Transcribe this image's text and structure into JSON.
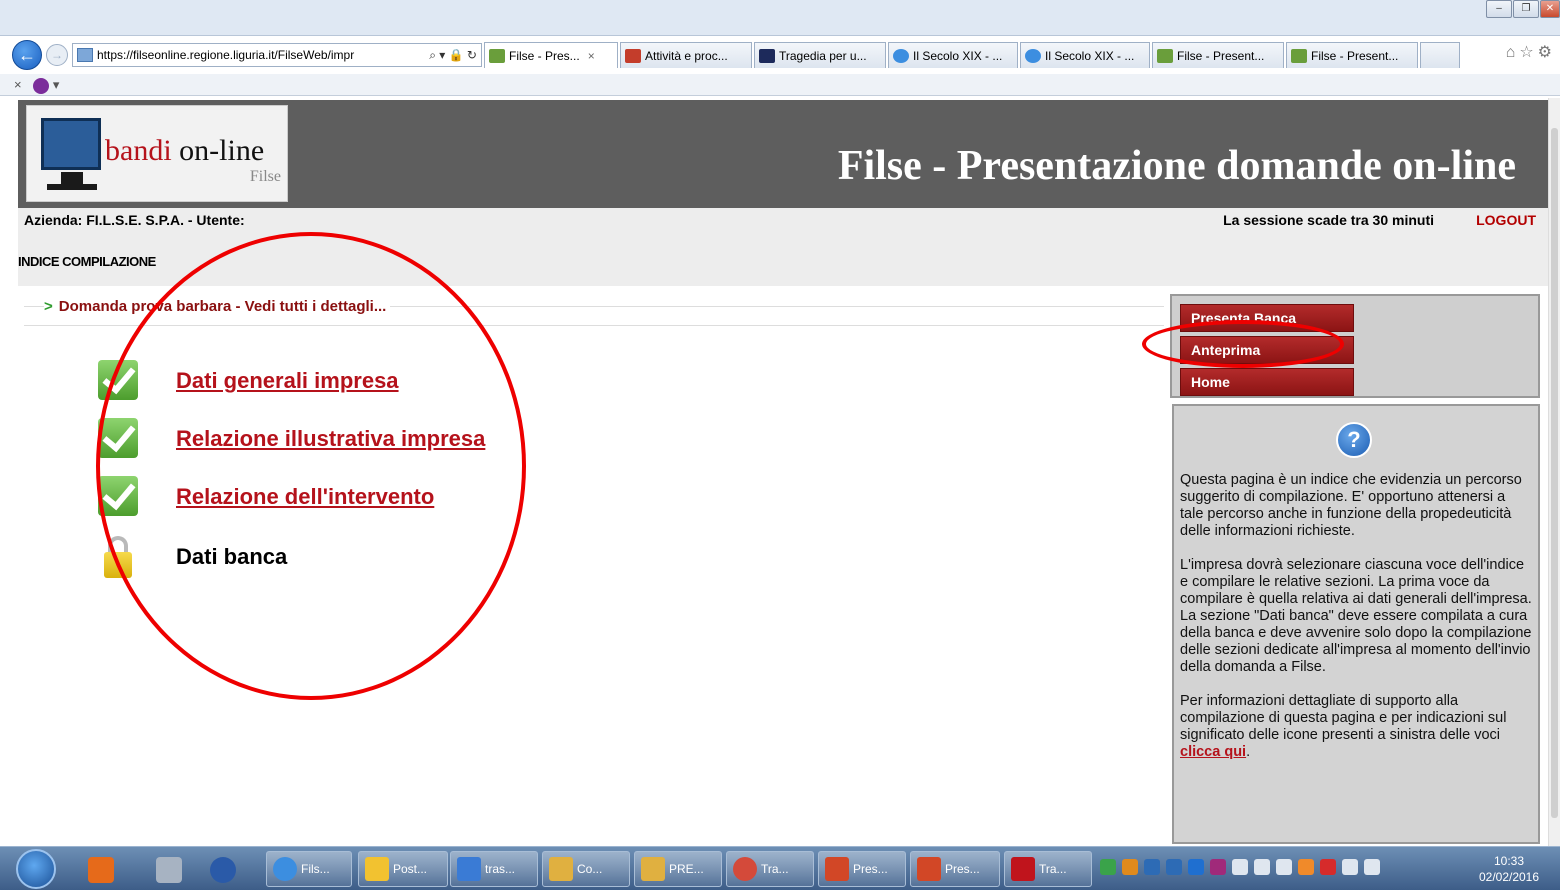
{
  "browser": {
    "url": "https://filseonline.regione.liguria.it/FilseWeb/impr",
    "address_controls": "⌕ ▾ 🔒 ↻",
    "tabs": [
      {
        "label": "Filse - Pres...",
        "close": "×",
        "color": "#6a9e3b"
      },
      {
        "label": "Attività e proc...",
        "color": "#c43d2b"
      },
      {
        "label": "Tragedia per u...",
        "color": "#1d2a5b"
      },
      {
        "label": "Il Secolo XIX - ...",
        "color": "#3c8ee0"
      },
      {
        "label": "Il Secolo XIX - ...",
        "color": "#3c8ee0"
      },
      {
        "label": "Filse - Present...",
        "color": "#6a9e3b"
      },
      {
        "label": "Filse - Present...",
        "color": "#6a9e3b"
      }
    ],
    "command_close": "×",
    "command_arrow": "▾"
  },
  "header": {
    "logo_text_a": "bandi",
    "logo_text_b": " on-line",
    "logo_sub": "Filse",
    "title": "Filse - Presentazione domande on-line"
  },
  "info": {
    "company": "Azienda: FI.L.S.E. S.P.A. - Utente:",
    "session": "La sessione scade tra 30 minuti",
    "logout": "LOGOUT",
    "index_heading": "INDICE COMPILAZIONE"
  },
  "breadcrumb": {
    "arrow": ">",
    "text": "Domanda prova barbara - Vedi tutti i dettagli..."
  },
  "index_items": [
    {
      "label": "Dati generali impresa",
      "status": "complete"
    },
    {
      "label": "Relazione illustrativa impresa",
      "status": "complete"
    },
    {
      "label": "Relazione dell'intervento",
      "status": "complete"
    },
    {
      "label": "Dati banca",
      "status": "locked"
    }
  ],
  "actions": {
    "presenta": "Presenta Banca",
    "anteprima": "Anteprima",
    "home": "Home"
  },
  "help": {
    "icon_glyph": "?",
    "p1": "Questa pagina è un indice che evidenzia un percorso suggerito di compilazione. E' opportuno attenersi a tale percorso anche in funzione della propedeuticità delle informazioni richieste.",
    "p2": "L'impresa dovrà selezionare ciascuna voce dell'indice e compilare le relative sezioni. La prima voce da compilare è quella relativa ai dati generali dell'impresa.",
    "p3": "La sezione \"Dati banca\" deve essere compilata a cura della banca e deve avvenire solo dopo la compilazione delle sezioni dedicate all'impresa al momento dell'invio della domanda a Filse.",
    "p4": "Per informazioni dettagliate di supporto alla compilazione di questa pagina e per indicazioni sul significato delle icone presenti a sinistra delle voci",
    "link": "clicca qui",
    "p4_end": "."
  },
  "taskbar": {
    "tasks": [
      {
        "label": "Fils...",
        "color": "#3c8ee0"
      },
      {
        "label": "Post...",
        "color": "#f2c230"
      },
      {
        "label": "tras...",
        "color": "#3a7bd5"
      },
      {
        "label": "Co...",
        "color": "#e0b040"
      },
      {
        "label": "PRE...",
        "color": "#e0b040"
      },
      {
        "label": "Tra...",
        "color": "#d44a3a"
      },
      {
        "label": "Pres...",
        "color": "#d24726"
      },
      {
        "label": "Pres...",
        "color": "#d24726"
      },
      {
        "label": "Tra...",
        "color": "#c0141c"
      }
    ],
    "time": "10:33",
    "date": "02/02/2016"
  },
  "colors": {
    "accent_red": "#b5121b",
    "header_gray": "#5e5e5e",
    "annotation_red": "#ee0000"
  }
}
